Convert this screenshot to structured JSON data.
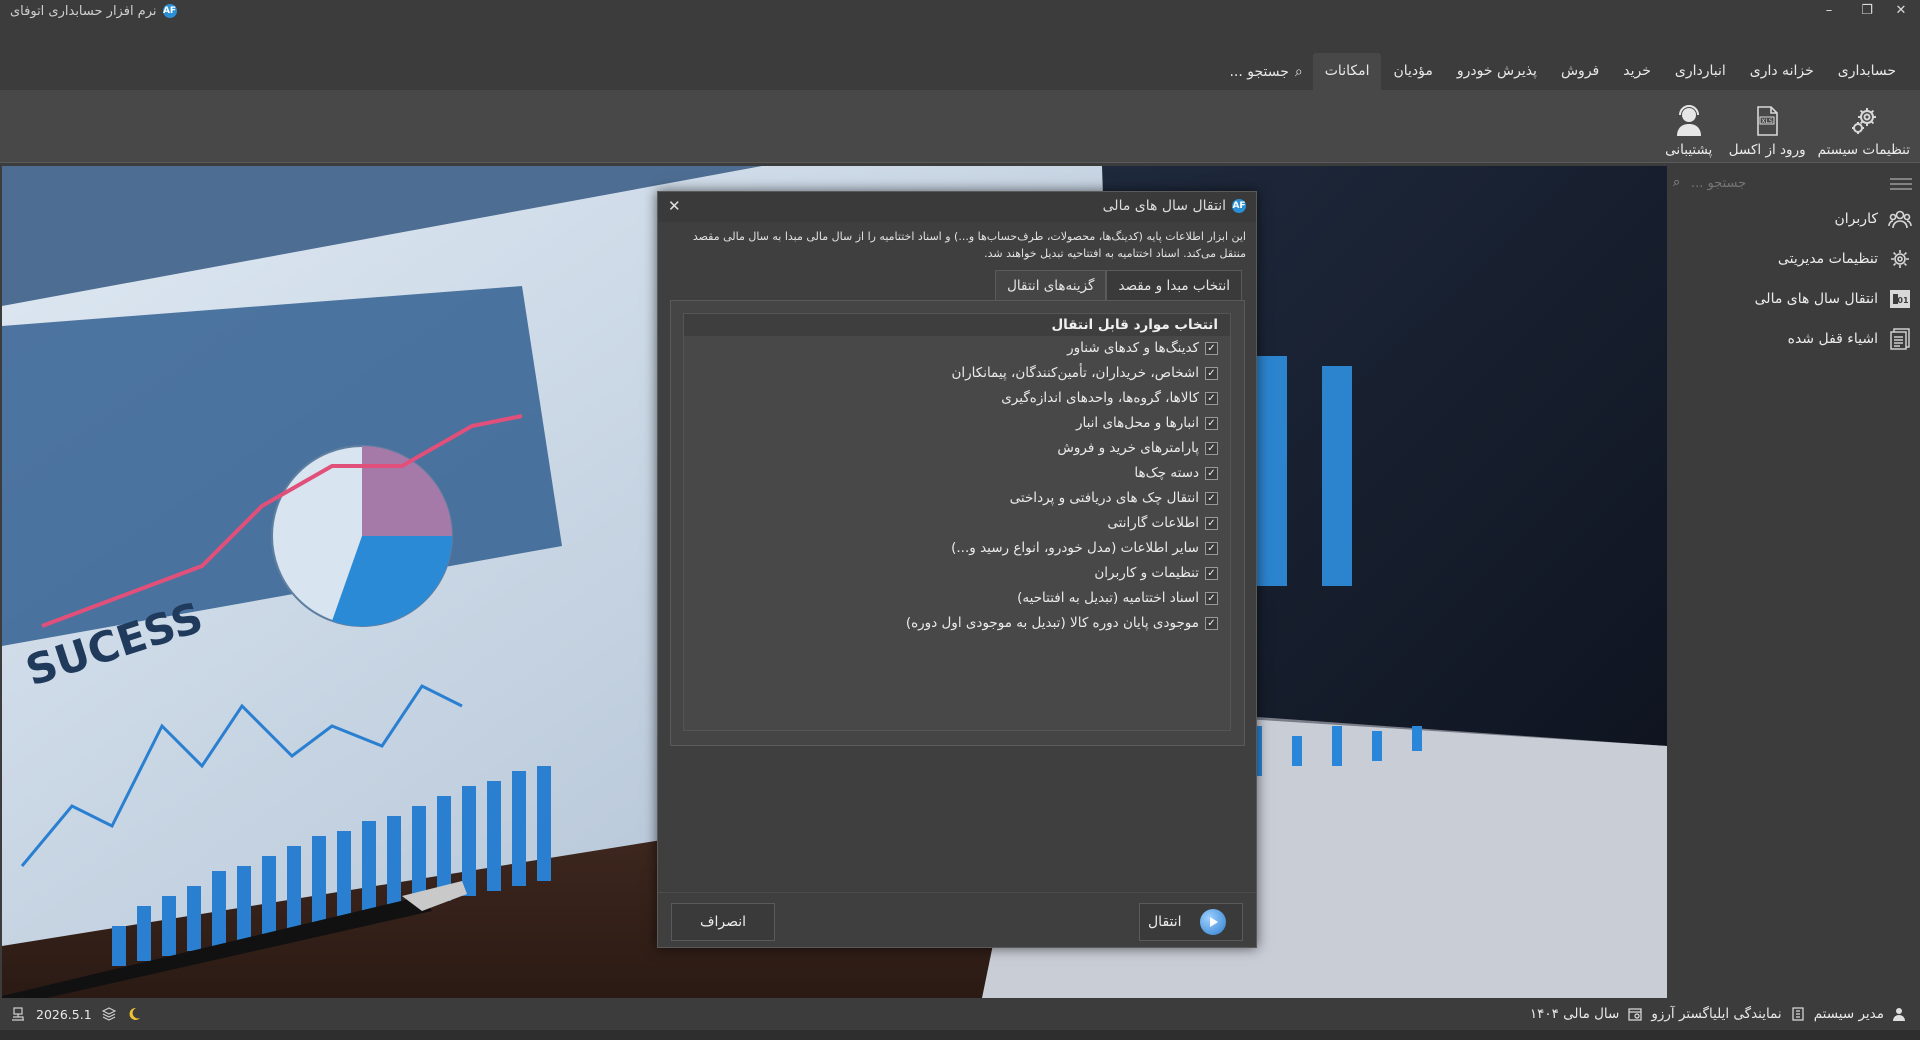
{
  "app": {
    "title": "نرم افزار حسابداری اتوفای",
    "logo_text": "AF",
    "window_controls": {
      "minimize": "–",
      "restore": "❐",
      "close": "✕"
    }
  },
  "menu": {
    "items": [
      {
        "label": "حسابداری",
        "active": false
      },
      {
        "label": "خزانه داری",
        "active": false
      },
      {
        "label": "انبارداری",
        "active": false
      },
      {
        "label": "خرید",
        "active": false
      },
      {
        "label": "فروش",
        "active": false
      },
      {
        "label": "پذیرش خودرو",
        "active": false
      },
      {
        "label": "مؤدیان",
        "active": false
      },
      {
        "label": "امکانات",
        "active": true
      }
    ],
    "search_label": "جستجو ..."
  },
  "ribbon": {
    "buttons": [
      {
        "label": "تنظیمات سیستم",
        "icon": "gear-icon"
      },
      {
        "label": "ورود از اکسل",
        "icon": "excel-file-icon"
      },
      {
        "label": "پشتیبانی",
        "icon": "support-person-icon"
      }
    ]
  },
  "sidepanel": {
    "search_placeholder": "جستجو ...",
    "items": [
      {
        "label": "کاربران",
        "icon": "users-icon"
      },
      {
        "label": "تنظیمات مدیریتی",
        "icon": "admin-gear-icon"
      },
      {
        "label": "انتقال سال های مالی",
        "icon": "fiscal-transfer-icon"
      },
      {
        "label": "اشیاء قفل شده",
        "icon": "locked-objects-icon"
      }
    ]
  },
  "dialog": {
    "title": "انتقال سال های مالی",
    "description": "این ابزار اطلاعات پایه (کدینگ‌ها، محصولات، طرف‌حساب‌ها و...) و اسناد اختتامیه را از سال مالی مبدا به سال مالی مقصد منتقل می‌کند. اسناد اختتامیه به افتتاحیه تبدیل خواهند شد.",
    "tabs": [
      {
        "label": "انتخاب مبدا و مقصد",
        "active": false
      },
      {
        "label": "گزینه‌های انتقال",
        "active": true
      }
    ],
    "list_header": "انتخاب موارد قابل انتقال",
    "options": [
      {
        "label": "کدینگ‌ها و کدهای شناور",
        "checked": true
      },
      {
        "label": "اشخاص، خریداران، تأمین‌کنندگان، پیمانکاران",
        "checked": true
      },
      {
        "label": "کالاها، گروه‌ها، واحدهای اندازه‌گیری",
        "checked": true
      },
      {
        "label": "انبارها و محل‌های انبار",
        "checked": true
      },
      {
        "label": "پارامترهای خرید و فروش",
        "checked": true
      },
      {
        "label": "دسته چک‌ها",
        "checked": true
      },
      {
        "label": "انتقال چک های دریافتی و پرداختی",
        "checked": true
      },
      {
        "label": "اطلاعات گارانتی",
        "checked": true
      },
      {
        "label": "سایر اطلاعات (مدل خودرو، انواع رسید و...)",
        "checked": true
      },
      {
        "label": "تنظیمات و کاربران",
        "checked": true
      },
      {
        "label": "اسناد اختتامیه (تبدیل به افتتاحیه)",
        "checked": true
      },
      {
        "label": "موجودی پایان دوره کالا (تبدیل به موجودی اول دوره)",
        "checked": true
      }
    ],
    "transfer_button": "انتقال",
    "cancel_button": "انصراف",
    "close_symbol": "✕",
    "check_symbol": "✓"
  },
  "status": {
    "user": "مدیر سیستم",
    "agency": "نمایندگی ایلیاگستر آرزو",
    "fiscal_year": "سال مالی ۱۴۰۴",
    "version": "2026.5.1"
  },
  "colors": {
    "background": "#3c3c3c",
    "accent": "#2a8fd4",
    "dialog_bg": "#3f3f3f"
  }
}
